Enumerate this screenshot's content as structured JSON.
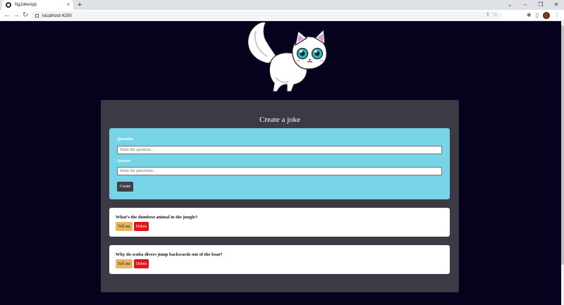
{
  "browser": {
    "tab_title": "NgJokeApp",
    "tab_close": "×",
    "new_tab": "+",
    "url": "localhost:4200",
    "window_controls": [
      "⌄",
      "–",
      "❐",
      "✕"
    ],
    "nav": {
      "back": "←",
      "forward": "→",
      "reload": "↻"
    },
    "toolbar_icons": [
      "share-icon",
      "star-icon",
      "extensions-icon",
      "sidebar-icon",
      "profile-avatar",
      "menu-icon"
    ]
  },
  "page": {
    "background": "#05021d",
    "mascot": "cat-mascot-illustration",
    "title": "Create a joke",
    "form": {
      "question_label": "Question",
      "question_placeholder": "Enter the question...",
      "answer_label": "Answer",
      "answer_placeholder": "Enter the punchline...",
      "create_label": "Create"
    },
    "jokes": [
      {
        "question": "What’s the dumbest animal in the jungle?",
        "tell_label": "Tell me",
        "delete_label": "Delete"
      },
      {
        "question": "Why do scuba divers jump backwards out of the boat?",
        "tell_label": "Tell me",
        "delete_label": "Delete"
      }
    ],
    "colors": {
      "container": "#3c3b45",
      "form_card": "#77d3e6",
      "tell_button": "#e6b75f",
      "delete_button": "#e2141b"
    }
  }
}
